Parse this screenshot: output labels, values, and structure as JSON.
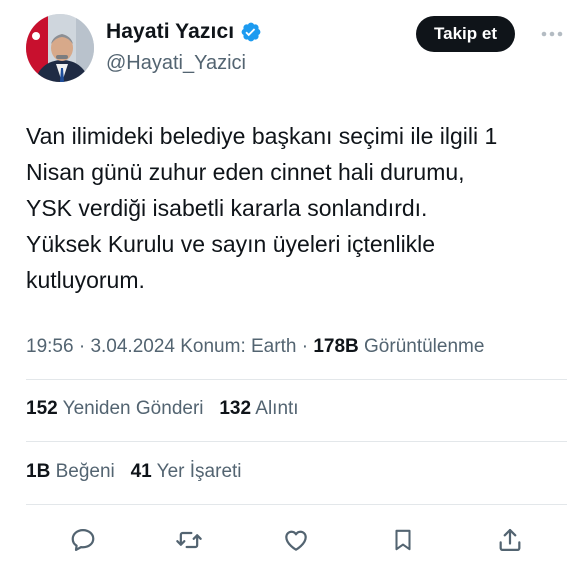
{
  "author": {
    "display_name": "Hayati Yazıcı",
    "handle": "@Hayati_Yazici",
    "verified_icon": "verified-badge-icon",
    "badge_color": "#1d9bf0"
  },
  "follow_button": {
    "label": "Takip et"
  },
  "tweet": {
    "lines": [
      "Van ilimideki belediye başkanı seçimi ile ilgili 1",
      "Nisan günü zuhur eden cinnet hali durumu,",
      "YSK verdiği isabetli kararla sonlandırdı.",
      "Yüksek Kurulu ve sayın üyeleri içtenlikle",
      "kutluyorum."
    ]
  },
  "meta": {
    "time": "19:56",
    "date": "3.04.2024",
    "location": "Konum: Earth",
    "views_count": "178B",
    "views_label": "Görüntülenme",
    "separator": "·"
  },
  "stats": {
    "reposts_count": "152",
    "reposts_label": "Yeniden Gönderi",
    "quotes_count": "132",
    "quotes_label": "Alıntı",
    "likes_count": "1B",
    "likes_label": "Beğeni",
    "bookmarks_count": "41",
    "bookmarks_label": "Yer İşareti"
  },
  "actions": [
    "reply-icon",
    "repost-icon",
    "like-icon",
    "bookmark-icon",
    "share-icon"
  ],
  "colors": {
    "text_primary": "#0f1419",
    "text_secondary": "#536471",
    "divider": "#e3e7ea",
    "button_bg": "#0f1419"
  }
}
